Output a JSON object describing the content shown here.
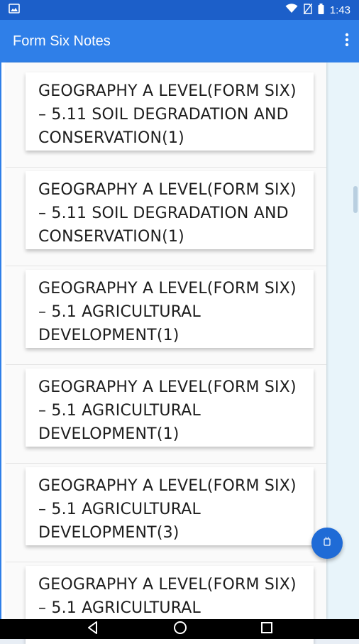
{
  "status_bar": {
    "time": "1:43",
    "icons": [
      "image-icon",
      "wifi-icon",
      "no-sim-icon",
      "battery-icon"
    ]
  },
  "app_bar": {
    "title": "Form Six Notes",
    "menu_icon": "more-vert-icon"
  },
  "notes": [
    {
      "title": "GEOGRAPHY A LEVEL(FORM SIX) – 5.11 SOIL DEGRADATION AND CONSERVATION(1)"
    },
    {
      "title": "GEOGRAPHY A LEVEL(FORM SIX) – 5.11 SOIL DEGRADATION AND CONSERVATION(1)"
    },
    {
      "title": "GEOGRAPHY A LEVEL(FORM SIX) – 5.1 AGRICULTURAL DEVELOPMENT(1)"
    },
    {
      "title": "GEOGRAPHY A LEVEL(FORM SIX) – 5.1 AGRICULTURAL DEVELOPMENT(1)"
    },
    {
      "title": "GEOGRAPHY A LEVEL(FORM SIX) – 5.1 AGRICULTURAL DEVELOPMENT(3)"
    },
    {
      "title": "GEOGRAPHY A LEVEL(FORM SIX) – 5.1 AGRICULTURAL"
    }
  ],
  "fab": {
    "icon": "android-icon"
  },
  "nav_bar": {
    "icons": [
      "back-icon",
      "home-icon",
      "recents-icon"
    ]
  },
  "colors": {
    "status_bar": "#1c5fc9",
    "app_bar": "#2f7fe8",
    "fab": "#1f6bd6"
  }
}
